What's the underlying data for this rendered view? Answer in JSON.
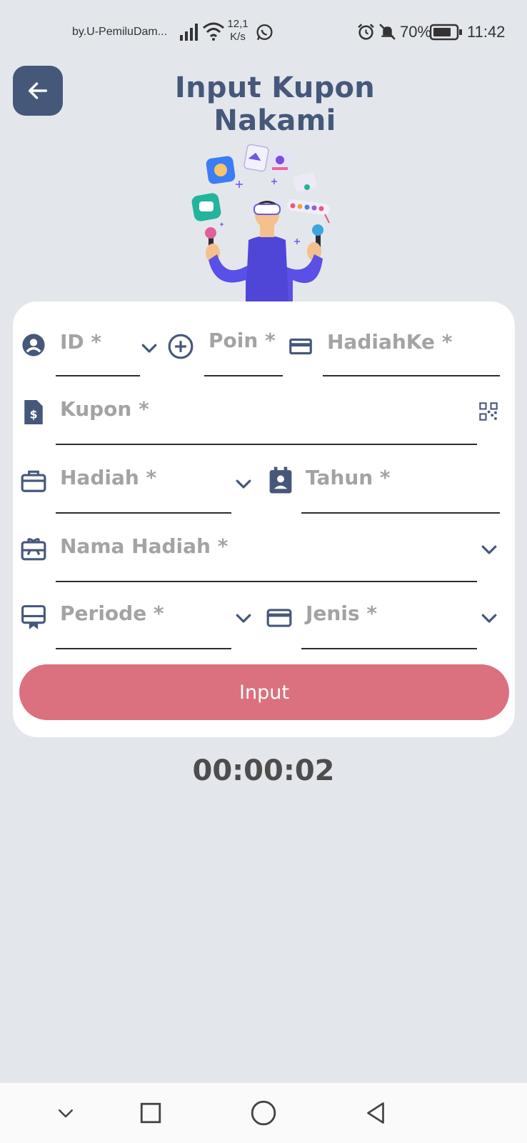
{
  "status_bar": {
    "app_text": "by.U-PemiluDam...",
    "speed_value": "12,1",
    "speed_unit": "K/s",
    "battery": "70%",
    "time": "11:42"
  },
  "header": {
    "back_icon": "arrow-left-icon",
    "title": "Input Kupon Nakami"
  },
  "form": {
    "id_placeholder": "ID *",
    "poin_placeholder": "Poin *",
    "hadiahke_placeholder": "HadiahKe *",
    "kupon_placeholder": "Kupon *",
    "hadiah_placeholder": "Hadiah *",
    "tahun_placeholder": "Tahun *",
    "nama_hadiah_placeholder": "Nama Hadiah *",
    "periode_placeholder": "Periode *",
    "jenis_placeholder": "Jenis *",
    "submit_label": "Input"
  },
  "timer": "00:00:02",
  "colors": {
    "accent": "#46587a",
    "button": "#db717e",
    "background": "#e3e6eb"
  }
}
